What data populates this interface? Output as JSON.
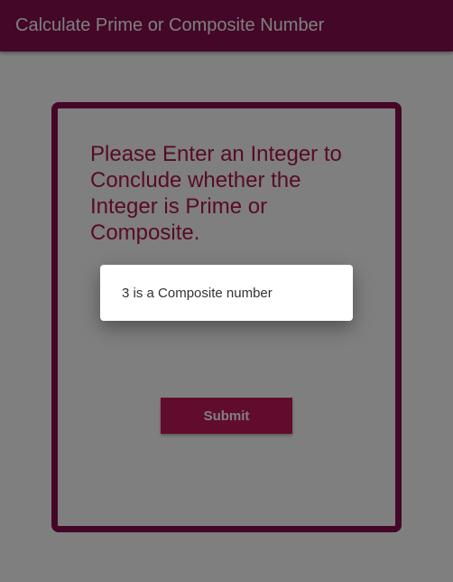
{
  "app_bar": {
    "title": "Calculate Prime or Composite Number"
  },
  "form": {
    "prompt": "Please Enter an Integer to Conclude whether the Integer is Prime or Composite.",
    "input_value": "",
    "submit_label": "Submit"
  },
  "dialog": {
    "message": "3 is a Composite number"
  },
  "colors": {
    "primary": "#880e4f",
    "accent": "#c2185b",
    "prompt_text": "#b0174d"
  }
}
